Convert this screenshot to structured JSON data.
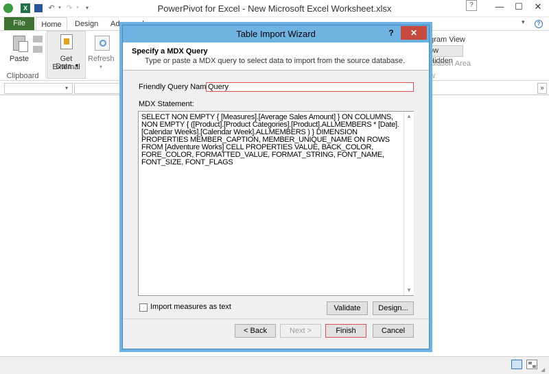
{
  "window": {
    "title": "PowerPivot for Excel - New Microsoft Excel Worksheet.xlsx",
    "minimize": "—",
    "maximize": "☐",
    "close": "✕"
  },
  "ribbon": {
    "tabs": [
      "File",
      "Home",
      "Design",
      "Advanced"
    ],
    "clipboard_group": "Clipboard",
    "paste": "Paste",
    "get_external_data": "Get External",
    "get_external_data_2": "Data",
    "refresh": "Refresh",
    "diagram_view": "agram View",
    "show_hidden": "ow Hidden",
    "calculation_area": "lculation Area",
    "view_group": "ew"
  },
  "dialog": {
    "title": "Table Import Wizard",
    "help": "?",
    "close": "✕",
    "header_title": "Specify a MDX Query",
    "header_subtitle": "Type or paste a MDX query to select data to import from the source database.",
    "friendly_name_label": "Friendly Query Name:",
    "friendly_name_value": "Query",
    "mdx_label": "MDX Statement:",
    "mdx_text": "SELECT NON EMPTY { [Measures].[Average Sales Amount] } ON COLUMNS, NON EMPTY { ([Product].[Product Categories].[Product].ALLMEMBERS * [Date].[Calendar Weeks].[Calendar Week].ALLMEMBERS ) } DIMENSION PROPERTIES MEMBER_CAPTION, MEMBER_UNIQUE_NAME ON ROWS FROM [Adventure Works] CELL PROPERTIES VALUE, BACK_COLOR, FORE_COLOR, FORMATTED_VALUE, FORMAT_STRING, FONT_NAME, FONT_SIZE, FONT_FLAGS",
    "import_measures_label": "Import measures as text",
    "validate": "Validate",
    "design": "Design...",
    "back": "< Back",
    "next": "Next >",
    "finish": "Finish",
    "cancel": "Cancel"
  },
  "colors": {
    "file_tab": "#3e7233",
    "dialog_title_bar": "#6fb3e3",
    "close_button": "#c74a3d",
    "highlight_border": "#e05050"
  }
}
